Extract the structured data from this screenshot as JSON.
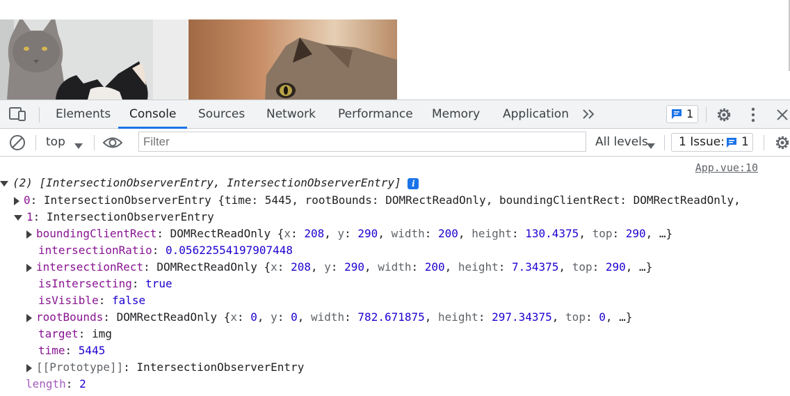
{
  "devtools": {
    "tabs": [
      {
        "label": "Elements"
      },
      {
        "label": "Console",
        "active": true
      },
      {
        "label": "Sources"
      },
      {
        "label": "Network"
      },
      {
        "label": "Performance"
      },
      {
        "label": "Memory"
      },
      {
        "label": "Application"
      }
    ],
    "messages_count": "1",
    "accent_color": "#1a73e8"
  },
  "toolbar": {
    "context": "top",
    "filter_placeholder": "Filter",
    "levels": "All levels",
    "issues_label": "1 Issue:",
    "issues_count": "1"
  },
  "console": {
    "source_link": "App.vue:10",
    "summary": "(2) [IntersectionObserverEntry, IntersectionObserverEntry]",
    "entry0": {
      "index": "0",
      "type": "IntersectionObserverEntry",
      "preview": "{time: 5445, rootBounds: DOMRectReadOnly, boundingClientRect: DOMRectReadOnly,"
    },
    "entry1": {
      "index": "1",
      "type": "IntersectionObserverEntry",
      "props": {
        "boundingClientRect": {
          "key": "boundingClientRect",
          "type": "DOMRectReadOnly",
          "x": "208",
          "y": "290",
          "width": "200",
          "height": "130.4375",
          "top": "290"
        },
        "intersectionRatio": {
          "key": "intersectionRatio",
          "value": "0.05622554197907448"
        },
        "intersectionRect": {
          "key": "intersectionRect",
          "type": "DOMRectReadOnly",
          "x": "208",
          "y": "290",
          "width": "200",
          "height": "7.34375",
          "top": "290"
        },
        "isIntersecting": {
          "key": "isIntersecting",
          "value": "true"
        },
        "isVisible": {
          "key": "isVisible",
          "value": "false"
        },
        "rootBounds": {
          "key": "rootBounds",
          "type": "DOMRectReadOnly",
          "x": "0",
          "y": "0",
          "width": "782.671875",
          "height": "297.34375",
          "top": "0"
        },
        "target": {
          "key": "target",
          "value": "img"
        },
        "time": {
          "key": "time",
          "value": "5445"
        },
        "prototype": {
          "key": "[[Prototype]]",
          "value": "IntersectionObserverEntry"
        }
      }
    },
    "length": {
      "key": "length",
      "value": "2"
    }
  }
}
